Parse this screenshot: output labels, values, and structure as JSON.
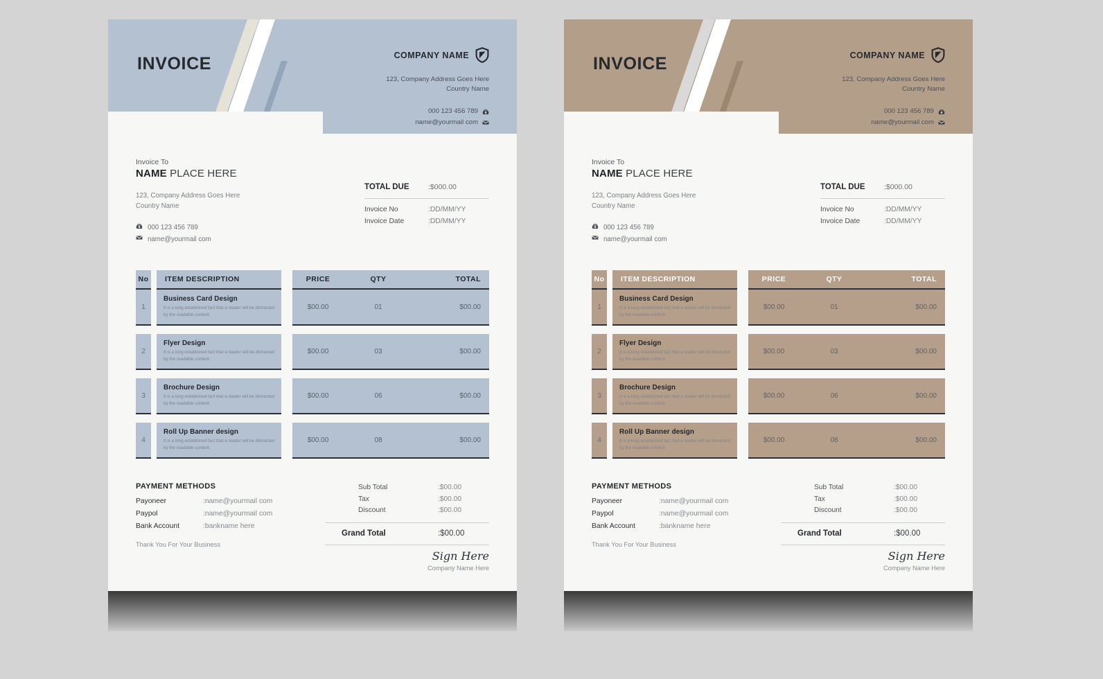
{
  "canvas": {
    "background": "#d4d4d4"
  },
  "variants": [
    {
      "id": "blue",
      "accent": "#b3c1d1",
      "accent_cell": "#b3c1d1",
      "header_text_color": "#23262b",
      "stripe_light": "#ffffff",
      "stripe_cream": "#e6e2d8",
      "stripe_dark": "#93a5bb",
      "header": {
        "title": "INVOICE",
        "company_name": "COMPANY NAME",
        "logo_icon": "shield-icon",
        "address_line1": "123, Company Address Goes Here",
        "address_line2": "Country Name",
        "phone": "000 123 456 789",
        "phone_icon": "phone-icon",
        "email": "name@yourmail com",
        "email_icon": "envelope-icon"
      },
      "bill_to": {
        "label": "Invoice To",
        "name_bold": "NAME",
        "name_rest": " PLACE HERE",
        "address_line1": "123, Company Address Goes Here",
        "address_line2": "Country Name",
        "phone": "000 123 456 789",
        "phone_icon": "phone-icon",
        "email": "name@yourmail com",
        "email_icon": "envelope-icon"
      },
      "total_due": {
        "label": "TOTAL DUE",
        "value": ":$000.00"
      },
      "meta": [
        {
          "key": "Invoice No",
          "value": ":DD/MM/YY"
        },
        {
          "key": "Invoice Date",
          "value": ":DD/MM/YY"
        }
      ],
      "table": {
        "headers": {
          "no": "No",
          "description": "ITEM DESCRIPTION",
          "price": "PRICE",
          "qty": "QTY",
          "total": "TOTAL"
        },
        "rows": [
          {
            "no": "1",
            "name": "Business Card Design",
            "desc": "It is a long established fact that a reader will be distracted by the readable content.",
            "price": "$00.00",
            "qty": "01",
            "total": "$00.00"
          },
          {
            "no": "2",
            "name": "Flyer Design",
            "desc": "It is a long established fact that a reader will be distracted by the readable content.",
            "price": "$00.00",
            "qty": "03",
            "total": "$00.00"
          },
          {
            "no": "3",
            "name": "Brochure Design",
            "desc": "It is a long established fact that a reader will be distracted by the readable content.",
            "price": "$00.00",
            "qty": "06",
            "total": "$00.00"
          },
          {
            "no": "4",
            "name": "Roll Up Banner design",
            "desc": "It is a long established fact that a reader will be distracted by the readable content.",
            "price": "$00.00",
            "qty": "08",
            "total": "$00.00"
          }
        ]
      },
      "payment": {
        "heading": "PAYMENT METHODS",
        "methods": [
          {
            "key": "Payoneer",
            "value": ":name@yourmail com"
          },
          {
            "key": "Paypol",
            "value": ":name@yourmail com"
          },
          {
            "key": "Bank Account",
            "value": ":bankname here"
          }
        ],
        "thanks": "Thank You For Your Business"
      },
      "summary": {
        "rows": [
          {
            "key": "Sub Total",
            "value": ":$00.00"
          },
          {
            "key": "Tax",
            "value": ":$00.00"
          },
          {
            "key": "Discount",
            "value": ":$00.00"
          }
        ],
        "grand_total_label": "Grand Total",
        "grand_total_value": ":$00.00",
        "sign_label": "Sign Here",
        "sign_sub": "Company Name Here"
      }
    },
    {
      "id": "tan",
      "accent": "#b39e89",
      "accent_cell": "#b69f8a",
      "header_text_color": "#ffffff",
      "stripe_light": "#ffffff",
      "stripe_cream": "#d9d9d9",
      "stripe_dark": "#9b8670",
      "header": {
        "title": "INVOICE",
        "company_name": "COMPANY NAME",
        "logo_icon": "shield-icon",
        "address_line1": "123, Company Address Goes Here",
        "address_line2": "Country Name",
        "phone": "000 123 456 789",
        "phone_icon": "phone-icon",
        "email": "name@yourmail com",
        "email_icon": "envelope-icon"
      },
      "bill_to": {
        "label": "Invoice To",
        "name_bold": "NAME",
        "name_rest": " PLACE HERE",
        "address_line1": "123, Company Address Goes Here",
        "address_line2": "Country Name",
        "phone": "000 123 456 789",
        "phone_icon": "phone-icon",
        "email": "name@yourmail com",
        "email_icon": "envelope-icon"
      },
      "total_due": {
        "label": "TOTAL DUE",
        "value": ":$000.00"
      },
      "meta": [
        {
          "key": "Invoice No",
          "value": ":DD/MM/YY"
        },
        {
          "key": "Invoice Date",
          "value": ":DD/MM/YY"
        }
      ],
      "table": {
        "headers": {
          "no": "No",
          "description": "ITEM DESCRIPTION",
          "price": "PRICE",
          "qty": "QTY",
          "total": "TOTAL"
        },
        "rows": [
          {
            "no": "1",
            "name": "Business Card Design",
            "desc": "It is a long established fact that a reader will be distracted by the readable content.",
            "price": "$00.00",
            "qty": "01",
            "total": "$00.00"
          },
          {
            "no": "2",
            "name": "Flyer Design",
            "desc": "It is a long established fact that a reader will be distracted by the readable content.",
            "price": "$00.00",
            "qty": "03",
            "total": "$00.00"
          },
          {
            "no": "3",
            "name": "Brochure Design",
            "desc": "It is a long established fact that a reader will be distracted by the readable content.",
            "price": "$00.00",
            "qty": "06",
            "total": "$00.00"
          },
          {
            "no": "4",
            "name": "Roll Up Banner design",
            "desc": "It is a long established fact that a reader will be distracted by the readable content.",
            "price": "$00.00",
            "qty": "08",
            "total": "$00.00"
          }
        ]
      },
      "payment": {
        "heading": "PAYMENT METHODS",
        "methods": [
          {
            "key": "Payoneer",
            "value": ":name@yourmail com"
          },
          {
            "key": "Paypol",
            "value": ":name@yourmail com"
          },
          {
            "key": "Bank Account",
            "value": ":bankname here"
          }
        ],
        "thanks": "Thank You For Your Business"
      },
      "summary": {
        "rows": [
          {
            "key": "Sub Total",
            "value": ":$00.00"
          },
          {
            "key": "Tax",
            "value": ":$00.00"
          },
          {
            "key": "Discount",
            "value": ":$00.00"
          }
        ],
        "grand_total_label": "Grand Total",
        "grand_total_value": ":$00.00",
        "sign_label": "Sign Here",
        "sign_sub": "Company Name Here"
      }
    }
  ]
}
